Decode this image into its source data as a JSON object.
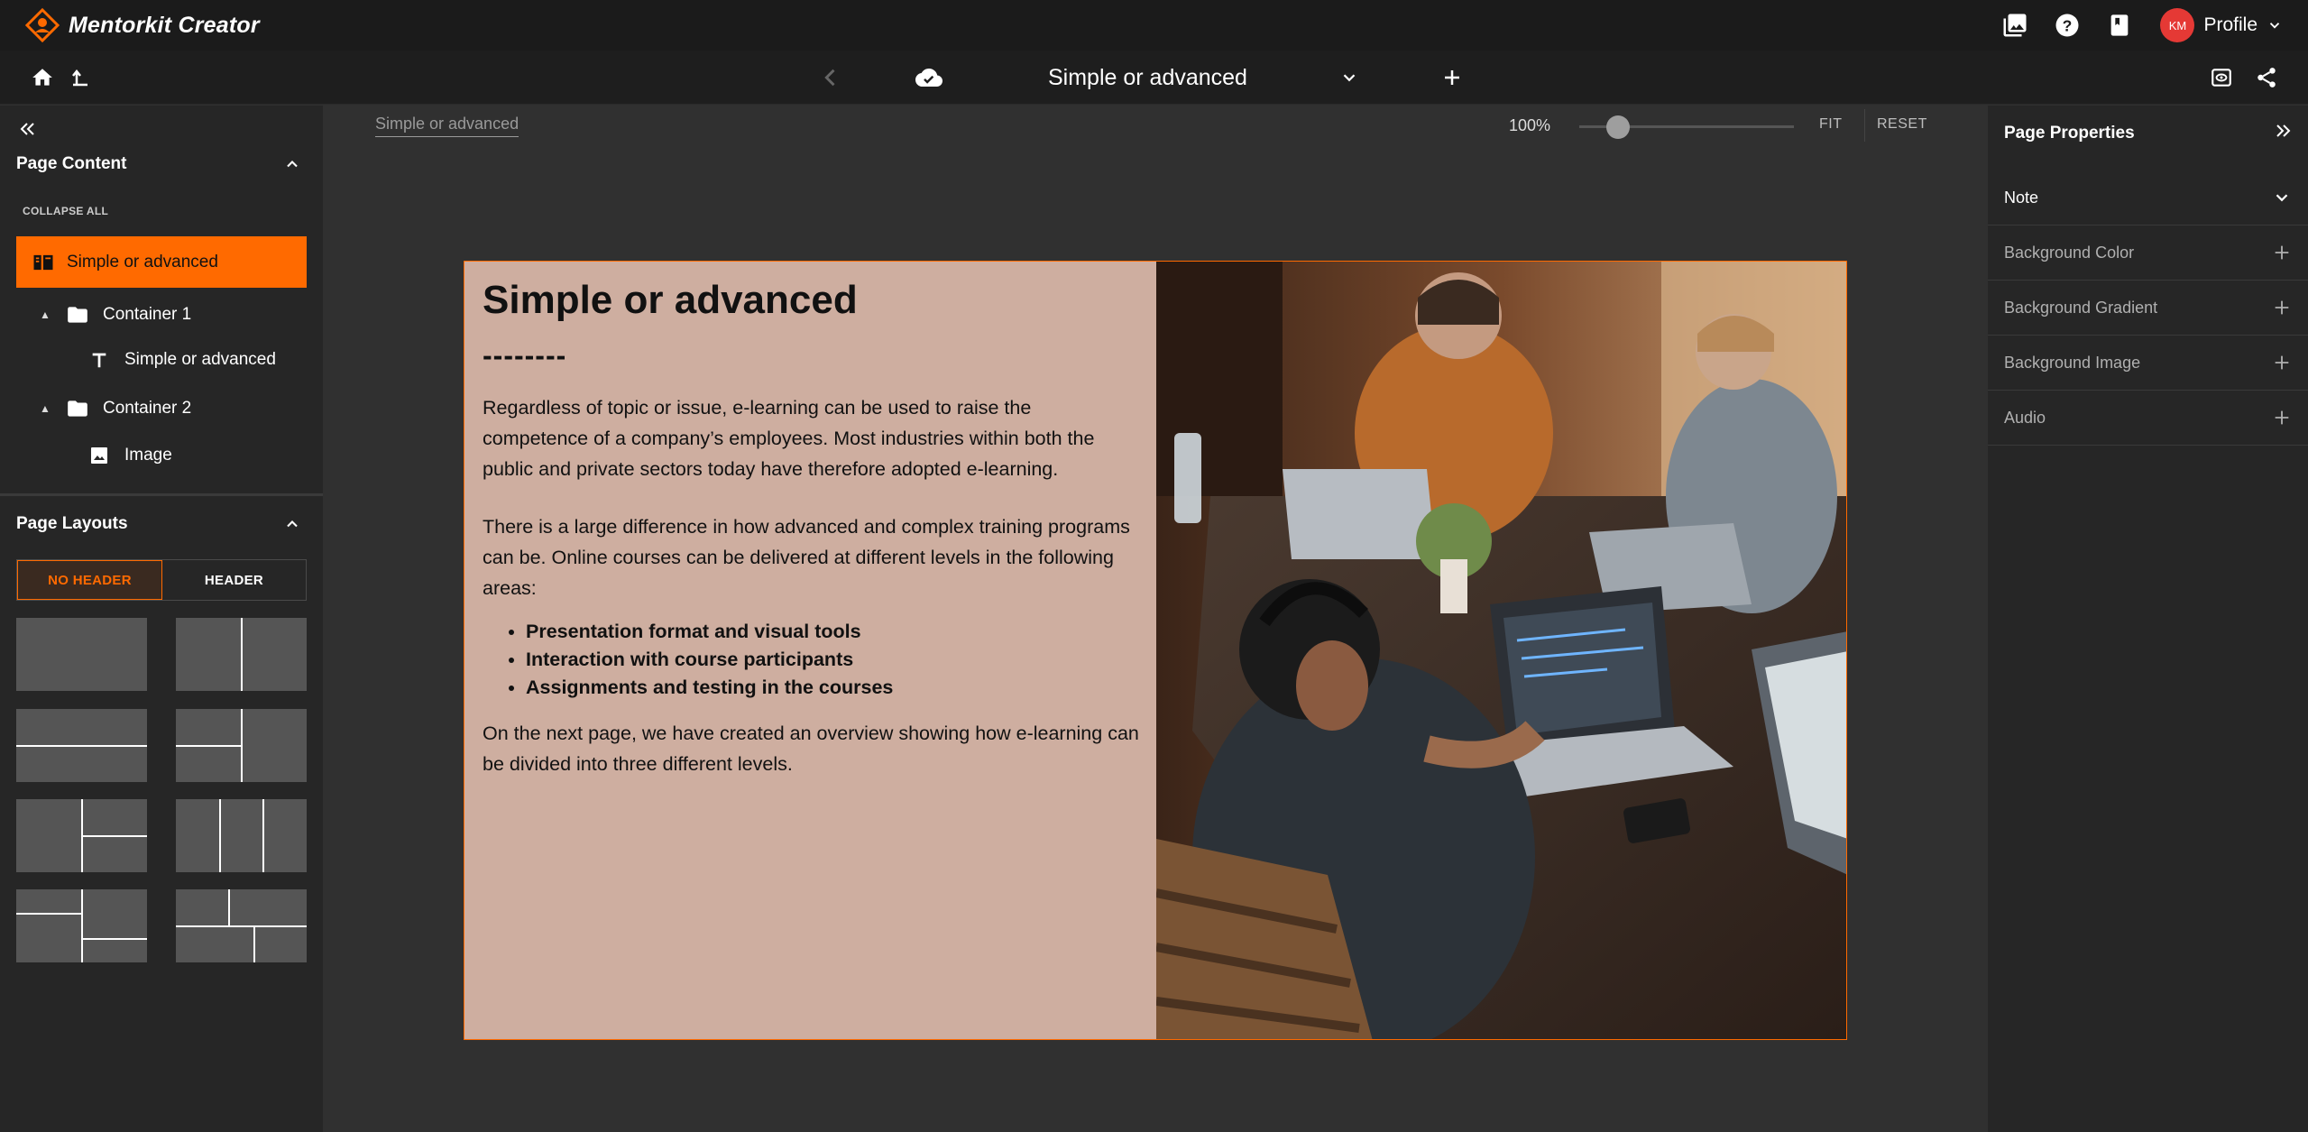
{
  "app": {
    "name": "Mentorkit Creator",
    "brand_color": "#ff6a00"
  },
  "topbar": {
    "profile": {
      "initials": "KM",
      "label": "Profile"
    },
    "icons": [
      "media-library-icon",
      "help-icon",
      "book-icon"
    ]
  },
  "navbar": {
    "page_title": "Simple or advanced"
  },
  "sidebar": {
    "page_content_title": "Page Content",
    "collapse_all": "COLLAPSE ALL",
    "tree": {
      "active": "Simple or advanced",
      "container1": "Container 1",
      "container1_child": "Simple or advanced",
      "container2": "Container 2",
      "container2_child": "Image"
    },
    "page_layouts_title": "Page Layouts",
    "tabs": {
      "no_header": "NO HEADER",
      "header": "HEADER"
    }
  },
  "canvas": {
    "breadcrumb": "Simple or advanced",
    "zoom": "100%",
    "zoom_level": 0.15,
    "fit": "FIT",
    "reset": "RESET"
  },
  "page": {
    "title": "Simple or advanced",
    "dashes": "--------",
    "p1": "Regardless of topic or issue, e-learning can be used to raise the competence of a company’s employees. Most industries within both the public and private sectors today have therefore adopted e-learning.",
    "p2": "There is a large difference in how advanced and complex training programs can be. Online courses can be delivered at different levels in the following areas:",
    "bullets": [
      "Presentation format and visual tools",
      "Interaction with course participants",
      "Assignments and testing in the courses"
    ],
    "p3": "On the next page, we have created an overview showing how e-learning can be divided into three different levels.",
    "background": "#ceaea0"
  },
  "properties": {
    "title": "Page Properties",
    "note": "Note",
    "bg_color": "Background Color",
    "bg_gradient": "Background Gradient",
    "bg_image": "Background Image",
    "audio": "Audio"
  }
}
